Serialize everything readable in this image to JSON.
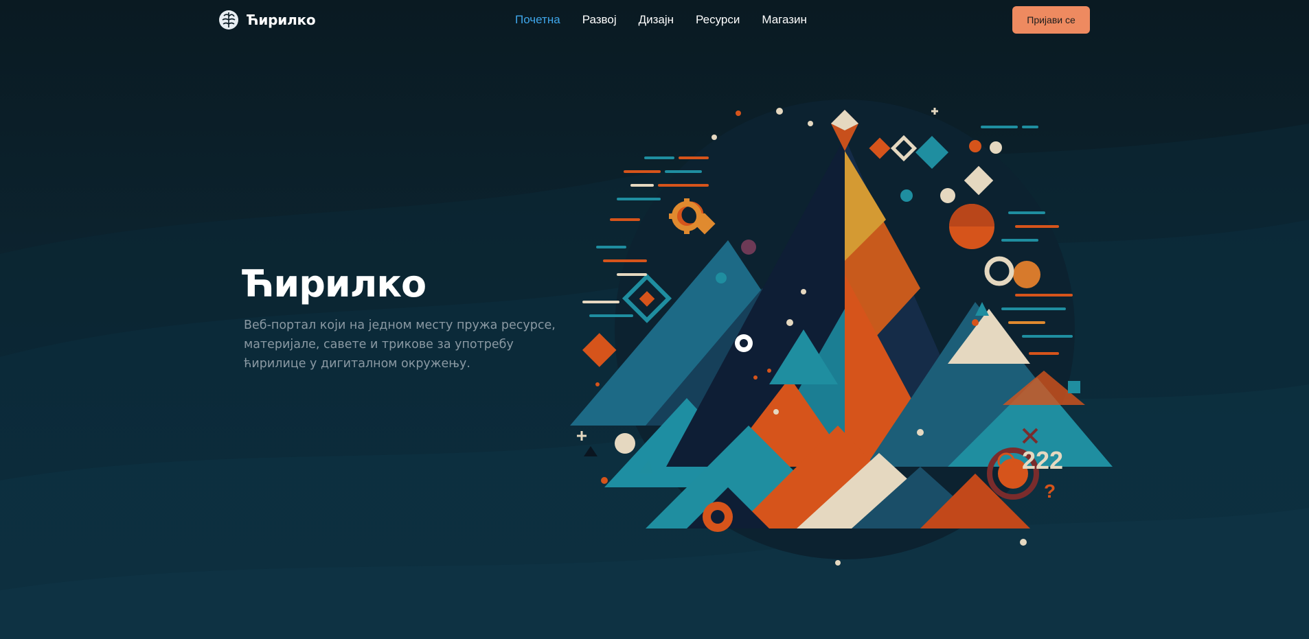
{
  "header": {
    "logo_text": "Ћирилко",
    "nav": [
      {
        "label": "Почетна",
        "active": true
      },
      {
        "label": "Развој"
      },
      {
        "label": "Дизајн"
      },
      {
        "label": "Ресурси"
      },
      {
        "label": "Магазин"
      }
    ],
    "login_label": "Пријави се"
  },
  "hero": {
    "title": "Ћирилко",
    "description": "Веб-портал који на једном месту пружа ресурсе, материјале, савете и трикове за употребу ћирилице у дигиталном окружењу."
  },
  "art": {
    "numbers_text": "222",
    "symbol_text": "?"
  },
  "colors": {
    "accent_nav": "#3fa6ea",
    "button": "#ee8a60",
    "orange": "#d6541b",
    "teal": "#1f8ea0",
    "navy": "#0d1f33",
    "cream": "#e5d8c0"
  }
}
